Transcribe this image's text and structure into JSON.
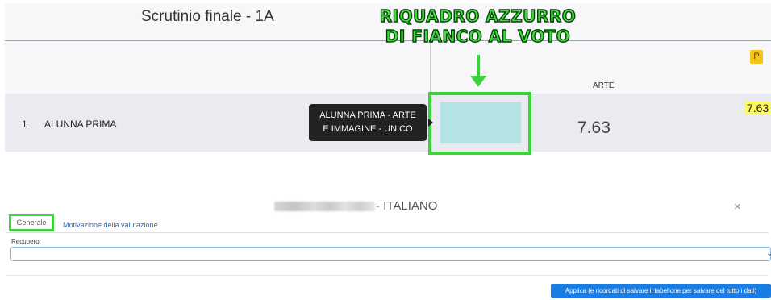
{
  "table": {
    "title": "Scrutinio finale - 1A",
    "badge": "P",
    "column_header": "ARTE",
    "row": {
      "number": "1",
      "name": "ALUNNA PRIMA",
      "vote": "7.63",
      "vote_highlight": "7.63"
    },
    "tooltip": {
      "line1": "ALUNNA PRIMA - ARTE",
      "line2": "E IMMAGINE - UNICO"
    }
  },
  "annotation": {
    "line1": "RIQUADRO AZZURRO",
    "line2": "DI FIANCO AL VOTO",
    "color": "#3bd23b"
  },
  "colors": {
    "cyan_box": "#b3e3e5",
    "badge": "#f5c518",
    "highlight": "#fff95e",
    "primary_button": "#1a7de3"
  },
  "dialog": {
    "title_suffix": "- ITALIANO",
    "close": "×",
    "tabs": [
      "Generale",
      "Motivazione della valutazione"
    ],
    "recupero_label": "Recupero:",
    "recupero_value": "",
    "apply_button": "Applica (e ricordati di salvare il tabellone per salvare del tutto i dati)"
  }
}
